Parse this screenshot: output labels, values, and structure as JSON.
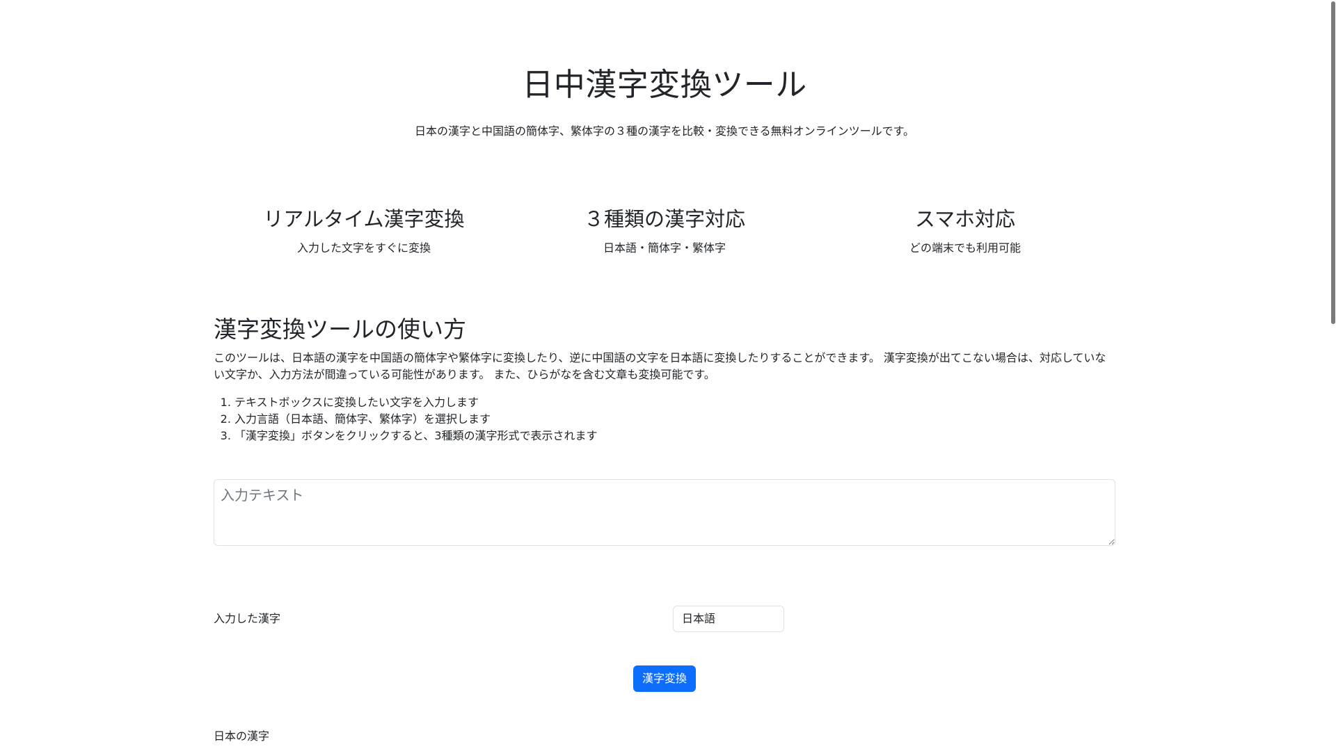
{
  "header": {
    "title": "日中漢字変換ツール",
    "subtitle": "日本の漢字と中国語の簡体字、繁体字の３種の漢字を比較・変換できる無料オンラインツールです。"
  },
  "features": [
    {
      "title": "リアルタイム漢字変換",
      "desc": "入力した文字をすぐに変換"
    },
    {
      "title": "３種類の漢字対応",
      "desc": "日本語・簡体字・繁体字"
    },
    {
      "title": "スマホ対応",
      "desc": "どの端末でも利用可能"
    }
  ],
  "howto": {
    "heading": "漢字変換ツールの使い方",
    "description": "このツールは、日本語の漢字を中国語の簡体字や繁体字に変換したり、逆に中国語の文字を日本語に変換したりすることができます。 漢字変換が出てこない場合は、対応していない文字か、入力方法が間違っている可能性があります。 また、ひらがなを含む文章も変換可能です。",
    "steps": [
      "テキストボックスに変換したい文字を入力します",
      "入力言語（日本語、簡体字、繁体字）を選択します",
      "「漢字変換」ボタンをクリックすると、3種類の漢字形式で表示されます"
    ]
  },
  "input": {
    "placeholder": "入力テキスト",
    "value": ""
  },
  "language": {
    "label": "入力した漢字",
    "selected": "日本語"
  },
  "convert_button": {
    "label": "漢字変換",
    "color": "#0d6efd"
  },
  "results": {
    "japanese_label": "日本の漢字"
  }
}
